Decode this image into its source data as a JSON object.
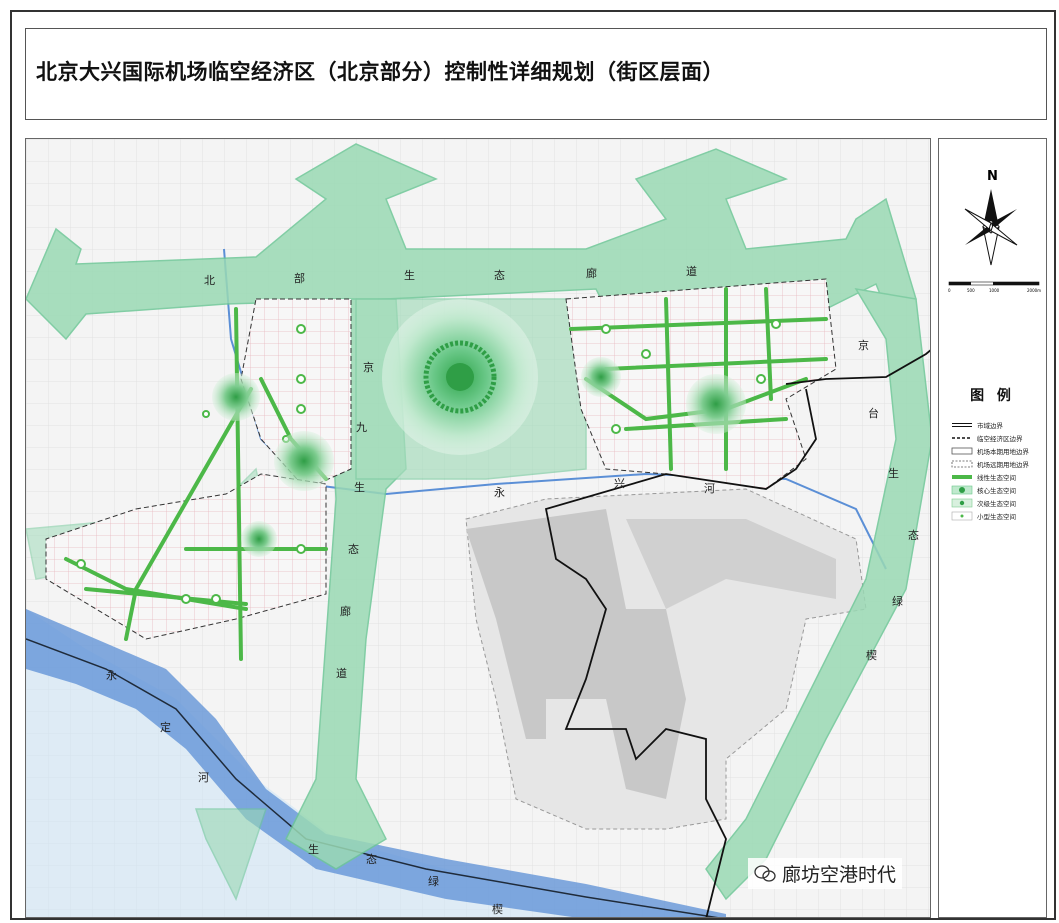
{
  "title": "北京大兴国际机场临空经济区（北京部分）控制性详细规划（街区层面）",
  "map": {
    "corridor_north": [
      "北",
      "部",
      "生",
      "态",
      "廊",
      "道"
    ],
    "corridor_jingjiu": [
      "京",
      "九",
      "生",
      "态",
      "廊",
      "道"
    ],
    "corridor_jingtai": [
      "京",
      "台",
      "生",
      "态",
      "绿",
      "楔"
    ],
    "river_yongxing": [
      "永",
      "兴",
      "河"
    ],
    "wedge_yongding": [
      "永",
      "定",
      "河",
      "生",
      "态",
      "绿",
      "楔"
    ]
  },
  "compass": {
    "label": "N"
  },
  "scale": {
    "ticks": [
      "0",
      "500",
      "1000",
      "2000m"
    ]
  },
  "legend": {
    "title": "图  例",
    "items": [
      {
        "label": "市域边界",
        "symbol": "double-line"
      },
      {
        "label": "临空经济区边界",
        "symbol": "dashed-bold"
      },
      {
        "label": "机场本期用地边界",
        "symbol": "thin-line"
      },
      {
        "label": "机场远期用地边界",
        "symbol": "dashed-thin"
      },
      {
        "label": "线性生态空间",
        "symbol": "green-line"
      },
      {
        "label": "核心生态空间",
        "symbol": "core-circle"
      },
      {
        "label": "次级生态空间",
        "symbol": "secondary-circle"
      },
      {
        "label": "小型生态空间",
        "symbol": "small-dot"
      }
    ]
  },
  "watermark": {
    "text": "廊坊空港时代"
  },
  "colors": {
    "corridor": "#9ad9b4",
    "corridor_edge": "#6ec797",
    "green_line": "#4cb848",
    "river": "#5b8fd6",
    "river_light": "#a9cbec",
    "airport": "#c8c8c8",
    "block_edge": "#e9a2ad"
  }
}
